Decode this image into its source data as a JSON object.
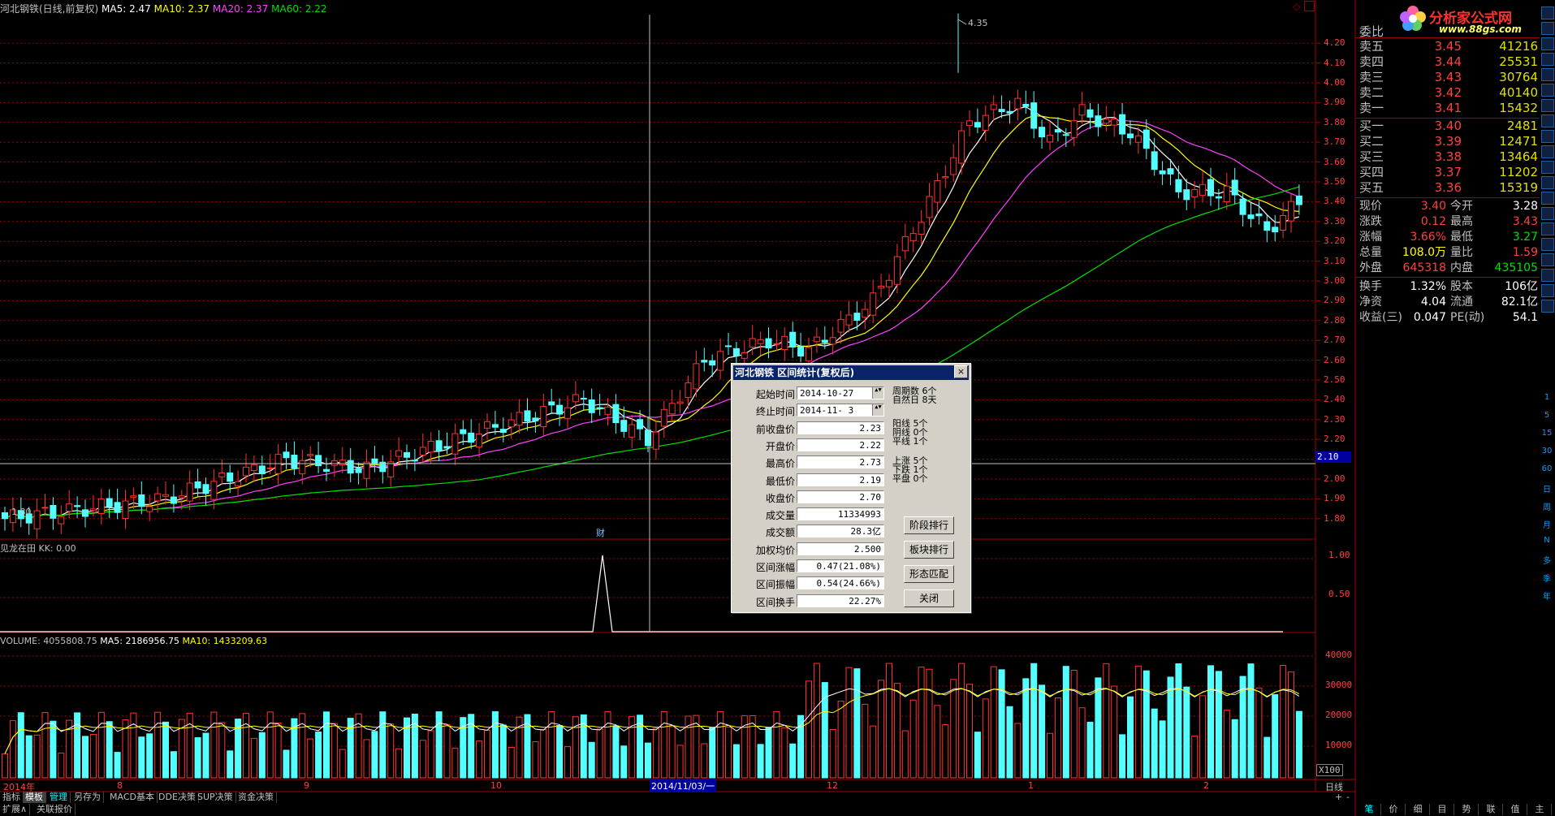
{
  "header": {
    "title": "河北钢铁(日线,前复权)",
    "ma5": "MA5: 2.47",
    "ma10": "MA10: 2.37",
    "ma20": "MA20: 2.37",
    "ma60": "MA60: 2.22",
    "colors": {
      "ma5": "#ffffff",
      "ma10": "#ffff00",
      "ma20": "#ff40ff",
      "ma60": "#00e000"
    }
  },
  "logo": {
    "text": "分析家公式网",
    "url": "www.88gs.com"
  },
  "price_axis": {
    "ticks": [
      "4.20",
      "4.10",
      "4.00",
      "3.90",
      "3.80",
      "3.70",
      "3.60",
      "3.50",
      "3.40",
      "3.30",
      "3.20",
      "3.10",
      "3.00",
      "2.90",
      "2.80",
      "2.70",
      "2.60",
      "2.50",
      "2.40",
      "2.30",
      "2.20",
      "2.10",
      "2.00",
      "1.90",
      "1.80"
    ],
    "crosshair_value": "2.10",
    "high_label": "4.35",
    "low_label": "1.80"
  },
  "indicator_panel": {
    "title": "见龙在田  KK: 0.00",
    "ticks": [
      "1.00",
      "0.50"
    ]
  },
  "volume_panel": {
    "title": "VOLUME: 4055808.75",
    "ma5": "MA5: 2186956.75",
    "ma10": "MA10: 1433209.63",
    "ticks": [
      "40000",
      "30000",
      "20000",
      "10000"
    ],
    "unit": "X100"
  },
  "date_axis": {
    "labels": [
      "2014年",
      "8",
      "9",
      "10",
      "2014/11/03/一",
      "12",
      "1",
      "2"
    ],
    "period": "日线"
  },
  "fin_marker": "财",
  "quote": {
    "ratio_label": "委比",
    "sell": [
      {
        "label": "卖五",
        "price": "3.45",
        "vol": "41216"
      },
      {
        "label": "卖四",
        "price": "3.44",
        "vol": "25531"
      },
      {
        "label": "卖三",
        "price": "3.43",
        "vol": "30764"
      },
      {
        "label": "卖二",
        "price": "3.42",
        "vol": "40140"
      },
      {
        "label": "卖一",
        "price": "3.41",
        "vol": "15432"
      }
    ],
    "buy": [
      {
        "label": "买一",
        "price": "3.40",
        "vol": "2481"
      },
      {
        "label": "买二",
        "price": "3.39",
        "vol": "12471"
      },
      {
        "label": "买三",
        "price": "3.38",
        "vol": "13464"
      },
      {
        "label": "买四",
        "price": "3.37",
        "vol": "11202"
      },
      {
        "label": "买五",
        "price": "3.36",
        "vol": "15319"
      }
    ],
    "stats": [
      {
        "l1": "现价",
        "v1": "3.40",
        "c1": "red",
        "l2": "今开",
        "v2": "3.28",
        "c2": "wht"
      },
      {
        "l1": "涨跌",
        "v1": "0.12",
        "c1": "red",
        "l2": "最高",
        "v2": "3.43",
        "c2": "red"
      },
      {
        "l1": "涨幅",
        "v1": "3.66%",
        "c1": "red",
        "l2": "最低",
        "v2": "3.27",
        "c2": "grn"
      },
      {
        "l1": "总量",
        "v1": "108.0万",
        "c1": "yel",
        "l2": "量比",
        "v2": "1.59",
        "c2": "red"
      },
      {
        "l1": "外盘",
        "v1": "645318",
        "c1": "red",
        "l2": "内盘",
        "v2": "435105",
        "c2": "grn"
      },
      {
        "l1": "换手",
        "v1": "1.32%",
        "c1": "wht",
        "l2": "股本",
        "v2": "106亿",
        "c2": "wht"
      },
      {
        "l1": "净资",
        "v1": "4.04",
        "c1": "wht",
        "l2": "流通",
        "v2": "82.1亿",
        "c2": "wht"
      },
      {
        "l1": "收益(三)",
        "v1": "0.047",
        "c1": "wht",
        "l2": "PE(动)",
        "v2": "54.1",
        "c2": "wht"
      }
    ]
  },
  "dialog": {
    "title": "河北钢铁 区间统计(复权后)",
    "close": "×",
    "fields": [
      {
        "label": "起始时间",
        "value": "2014-10-27",
        "date": true
      },
      {
        "label": "终止时间",
        "value": "2014-11- 3",
        "date": true
      },
      {
        "label": "前收盘价",
        "value": "2.23"
      },
      {
        "label": "开盘价",
        "value": "2.22"
      },
      {
        "label": "最高价",
        "value": "2.73"
      },
      {
        "label": "最低价",
        "value": "2.19"
      },
      {
        "label": "收盘价",
        "value": "2.70"
      },
      {
        "label": "成交量",
        "value": "11334993"
      },
      {
        "label": "成交额",
        "value": "28.3亿"
      },
      {
        "label": "加权均价",
        "value": "2.500"
      },
      {
        "label": "区间涨幅",
        "value": "0.47(21.08%)"
      },
      {
        "label": "区间振幅",
        "value": "0.54(24.66%)"
      },
      {
        "label": "区间换手",
        "value": "22.27%"
      }
    ],
    "stats": {
      "periods": "周期数  6个",
      "natural": "自然日  8天",
      "yang": "阳线  5个",
      "yin": "阴线  0个",
      "flat": "平线  1个",
      "up": "上涨  5个",
      "down": "下跌  1个",
      "even": "平盘  0个"
    },
    "buttons": [
      "阶段排行",
      "板块排行",
      "形态匹配",
      "关闭"
    ]
  },
  "bottom_tabs": [
    "指标",
    "模板",
    "管理",
    "另存为",
    "MACD基本",
    "DDE决策",
    "SUP决策",
    "资金决策"
  ],
  "bottom_tabs2": [
    "扩展∧",
    "关联报价"
  ],
  "right_tabs": [
    "笔",
    "价",
    "细",
    "目",
    "势",
    "联",
    "值",
    "主"
  ],
  "side_icons": [
    "1",
    "5",
    "15",
    "30",
    "60",
    "日",
    "周",
    "月",
    "N",
    "多",
    "季",
    "年"
  ],
  "zoom": {
    "plus": "+",
    "minus": "-"
  }
}
